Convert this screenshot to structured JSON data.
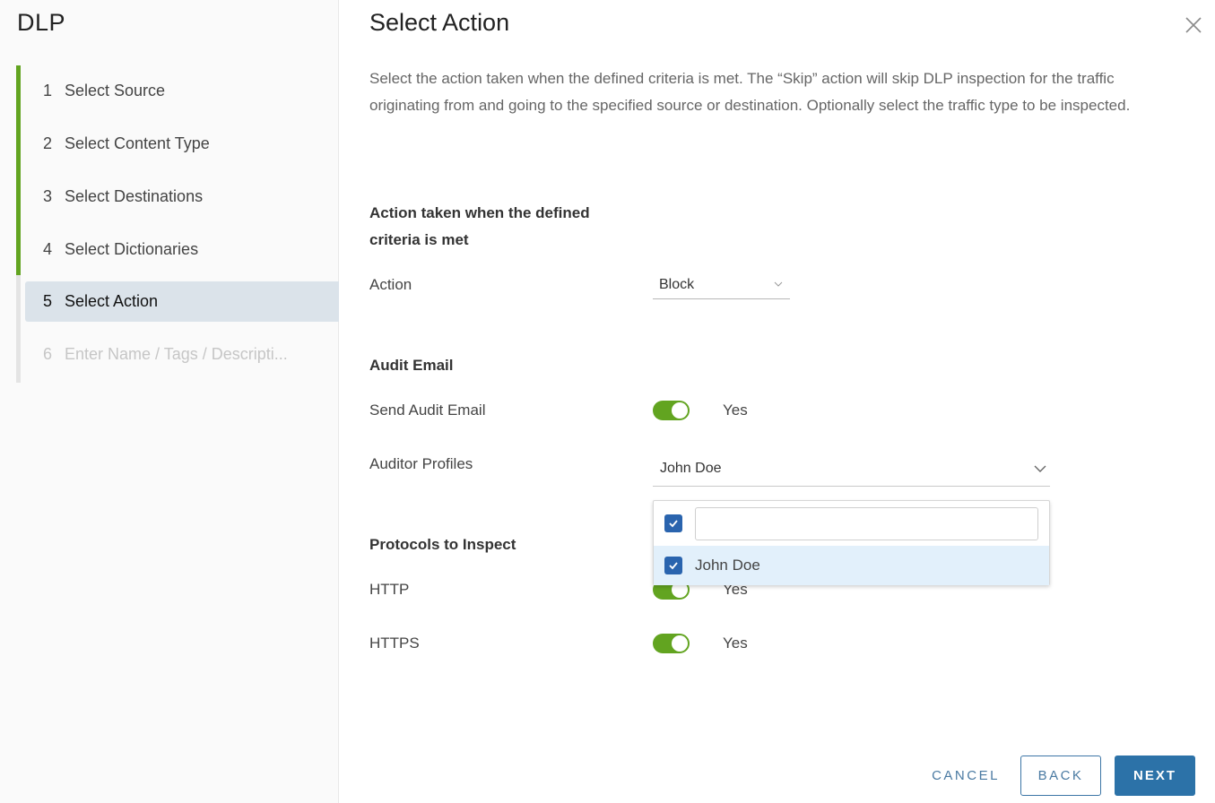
{
  "sidebar": {
    "title": "DLP",
    "steps": [
      {
        "num": "1",
        "label": "Select Source",
        "state": "completed"
      },
      {
        "num": "2",
        "label": "Select Content Type",
        "state": "completed"
      },
      {
        "num": "3",
        "label": "Select Destinations",
        "state": "completed"
      },
      {
        "num": "4",
        "label": "Select Dictionaries",
        "state": "completed"
      },
      {
        "num": "5",
        "label": "Select Action",
        "state": "active"
      },
      {
        "num": "6",
        "label": "Enter Name / Tags / Descripti...",
        "state": "disabled"
      }
    ]
  },
  "main": {
    "title": "Select Action",
    "description": "Select the action taken when the defined criteria is met. The “Skip” action will skip DLP inspection for the traffic originating from and going to the specified source or destination. Optionally select the traffic type to be inspected.",
    "action_section": {
      "heading": "Action taken when the defined criteria is met",
      "action_label": "Action",
      "action_value": "Block"
    },
    "audit_section": {
      "heading": "Audit Email",
      "send_label": "Send Audit Email",
      "send_enabled": true,
      "send_text": "Yes",
      "auditor_label": "Auditor Profiles",
      "auditor_value": "John Doe",
      "dropdown": {
        "select_all_checked": true,
        "search_value": "",
        "options": [
          {
            "label": "John Doe",
            "checked": true
          }
        ]
      }
    },
    "protocols_section": {
      "heading": "Protocols to Inspect",
      "http_label": "HTTP",
      "http_enabled": true,
      "http_text": "Yes",
      "https_label": "HTTPS",
      "https_enabled": true,
      "https_text": "Yes"
    }
  },
  "footer": {
    "cancel_label": "CANCEL",
    "back_label": "BACK",
    "next_label": "NEXT"
  },
  "colors": {
    "progress_green": "#62a420",
    "primary_blue": "#2c72a8",
    "checkbox_blue": "#2a64ae",
    "active_step_bg": "#dbe3ea",
    "option_highlight": "#e2f0fb"
  }
}
